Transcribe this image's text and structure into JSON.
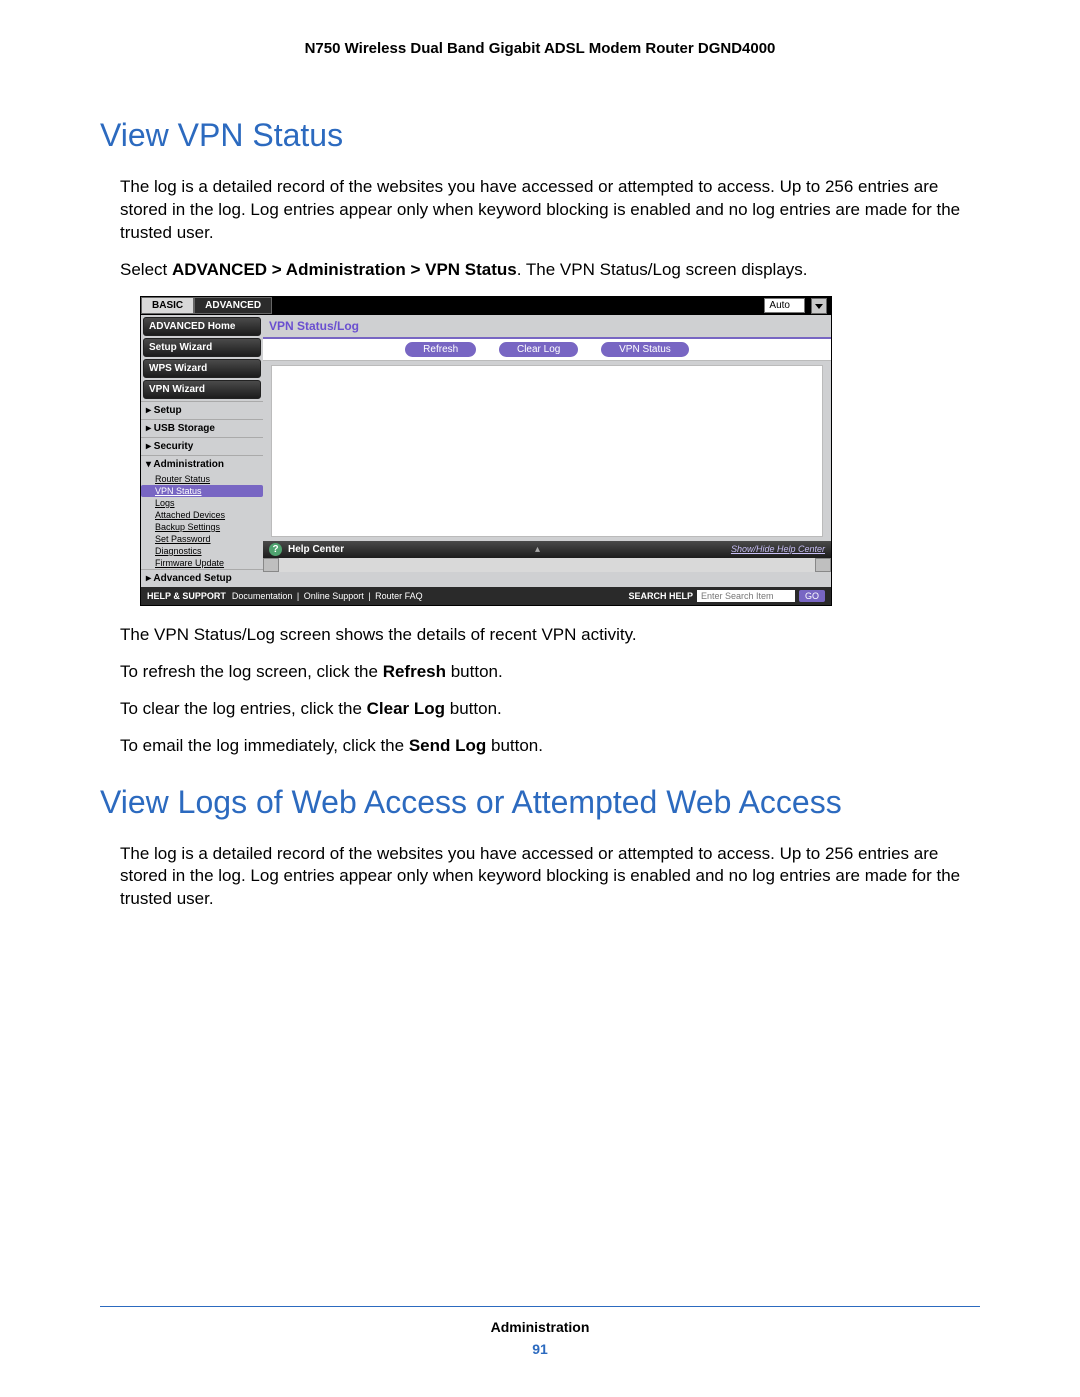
{
  "doc_header": "N750 Wireless Dual Band Gigabit ADSL Modem Router DGND4000",
  "sec1": {
    "title": "View VPN Status",
    "p1": "The log is a detailed record of the websites you have accessed or attempted to access. Up to 256 entries are stored in the log. Log entries appear only when keyword blocking is enabled and no log entries are made for the trusted user.",
    "p2a": "Select ",
    "p2b": "ADVANCED > Administration > VPN Status",
    "p2c": ". The VPN Status/Log screen displays.",
    "after1": "The VPN Status/Log screen shows the details of recent VPN activity.",
    "after2a": "To refresh the log screen, click the ",
    "after2b": "Refresh",
    "after2c": " button.",
    "after3a": "To clear the log entries, click the ",
    "after3b": "Clear Log",
    "after3c": " button.",
    "after4a": "To email the log immediately, click the ",
    "after4b": "Send Log",
    "after4c": " button."
  },
  "sec2": {
    "title": "View Logs of Web Access or Attempted Web Access",
    "p1": "The log is a detailed record of the websites you have accessed or attempted to access. Up to 256 entries are stored in the log. Log entries appear only when keyword blocking is enabled and no log entries are made for the trusted user."
  },
  "shot": {
    "tabs": {
      "basic": "BASIC",
      "advanced": "ADVANCED",
      "lang": "Auto"
    },
    "nav": {
      "home": "ADVANCED Home",
      "setup_wiz": "Setup Wizard",
      "wps_wiz": "WPS Wizard",
      "vpn_wiz": "VPN Wizard",
      "grp_setup": "▸ Setup",
      "grp_usb": "▸ USB Storage",
      "grp_sec": "▸ Security",
      "grp_admin": "▾ Administration",
      "admin_items": [
        "Router Status",
        "VPN Status",
        "Logs",
        "Attached Devices",
        "Backup Settings",
        "Set Password",
        "Diagnostics",
        "Firmware Update"
      ],
      "grp_advsetup": "▸ Advanced Setup"
    },
    "main": {
      "title": "VPN Status/Log",
      "btn_refresh": "Refresh",
      "btn_clear": "Clear Log",
      "btn_vpn": "VPN Status"
    },
    "help_center": {
      "label": "Help Center",
      "link": "Show/Hide Help Center"
    },
    "footer": {
      "hs": "HELP & SUPPORT",
      "l1": "Documentation",
      "l2": "Online Support",
      "l3": "Router FAQ",
      "search_label": "SEARCH HELP",
      "search_ph": "Enter Search Item",
      "go": "GO"
    }
  },
  "page_footer": {
    "section": "Administration",
    "page": "91"
  }
}
